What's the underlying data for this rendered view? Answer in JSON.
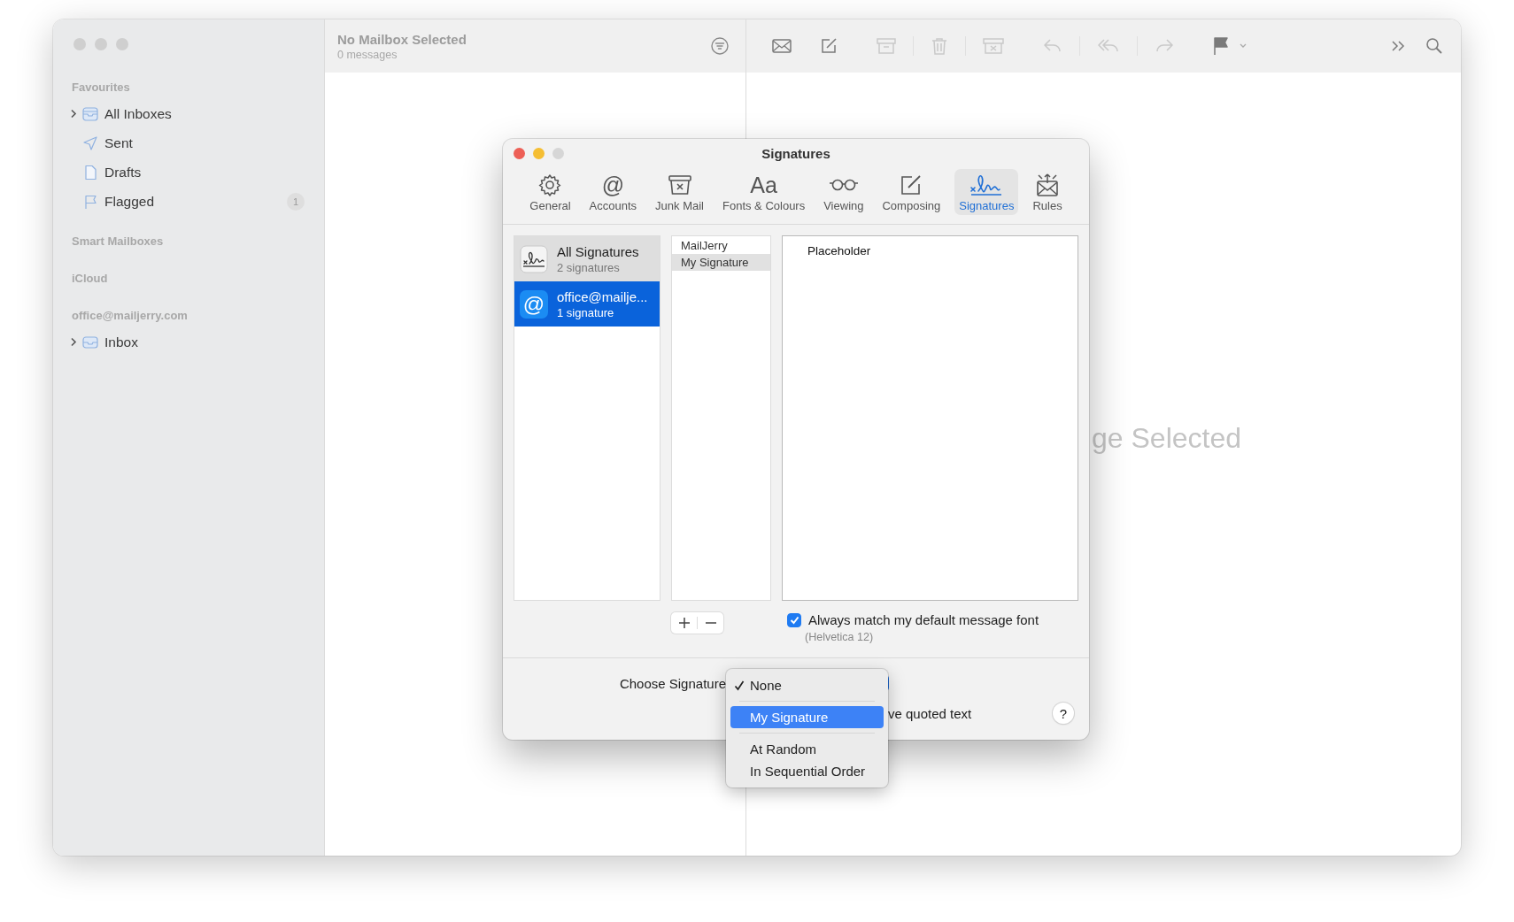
{
  "sidebar": {
    "sections": [
      {
        "title": "Favourites",
        "items": [
          {
            "label": "All Inboxes",
            "kind": "inboxes",
            "expandable": true
          },
          {
            "label": "Sent",
            "kind": "sent",
            "expandable": false
          },
          {
            "label": "Drafts",
            "kind": "drafts",
            "expandable": false
          },
          {
            "label": "Flagged",
            "kind": "flagged",
            "expandable": false,
            "count": "1"
          }
        ]
      },
      {
        "title": "Smart Mailboxes"
      },
      {
        "title": "iCloud"
      },
      {
        "title": "office@mailjerry.com",
        "items": [
          {
            "label": "Inbox",
            "kind": "inbox",
            "expandable": true
          }
        ]
      }
    ]
  },
  "message_list": {
    "title": "No Mailbox Selected",
    "subtitle": "0 messages"
  },
  "toolbar_buttons": [
    {
      "kind": "get-mail",
      "disabled": false
    },
    {
      "kind": "compose",
      "disabled": false
    },
    {
      "kind": "archive",
      "disabled": true
    },
    {
      "kind": "trash",
      "disabled": true
    },
    {
      "kind": "junk",
      "disabled": true
    },
    {
      "kind": "reply",
      "disabled": true
    },
    {
      "kind": "reply-all",
      "disabled": true
    },
    {
      "kind": "forward",
      "disabled": true
    },
    {
      "kind": "flag",
      "disabled": false
    }
  ],
  "viewer": {
    "empty_text": "ge Selected"
  },
  "dialog": {
    "title": "Signatures",
    "tabs": [
      {
        "label": "General",
        "kind": "gear",
        "selected": false
      },
      {
        "label": "Accounts",
        "kind": "glyph",
        "glyph": "@",
        "selected": false
      },
      {
        "label": "Junk Mail",
        "kind": "junk",
        "selected": false
      },
      {
        "label": "Fonts & Colours",
        "kind": "glyph",
        "glyph": "Aa",
        "selected": false
      },
      {
        "label": "Viewing",
        "kind": "glasses",
        "selected": false
      },
      {
        "label": "Composing",
        "kind": "compose",
        "selected": false
      },
      {
        "label": "Signatures",
        "kind": "signature",
        "selected": true
      },
      {
        "label": "Rules",
        "kind": "rules",
        "selected": false
      }
    ],
    "accounts": [
      {
        "title": "All Signatures",
        "subtitle": "2 signatures",
        "kind": "all",
        "selected": false
      },
      {
        "title": "office@mailje...",
        "subtitle": "1 signature",
        "kind": "account",
        "glyph": "@",
        "selected": true
      }
    ],
    "signatures": [
      {
        "label": "MailJerry",
        "selected": false
      },
      {
        "label": "My Signature",
        "selected": true
      }
    ],
    "editor_text": "Placeholder",
    "match_font": {
      "label": "Always match my default message font",
      "checked": true,
      "note": "(Helvetica 12)"
    },
    "choose_label": "Choose Signature",
    "quote_fragment": "ve quoted text",
    "help": "?"
  },
  "menu": {
    "items": [
      {
        "kind": "option",
        "label": "None",
        "checked": true,
        "selected": false
      },
      {
        "kind": "separator"
      },
      {
        "kind": "option",
        "label": "My Signature",
        "checked": false,
        "selected": true
      },
      {
        "kind": "separator"
      },
      {
        "kind": "option",
        "label": "At Random",
        "checked": false,
        "selected": false
      },
      {
        "kind": "option",
        "label": "In Sequential Order",
        "checked": false,
        "selected": false
      }
    ]
  }
}
